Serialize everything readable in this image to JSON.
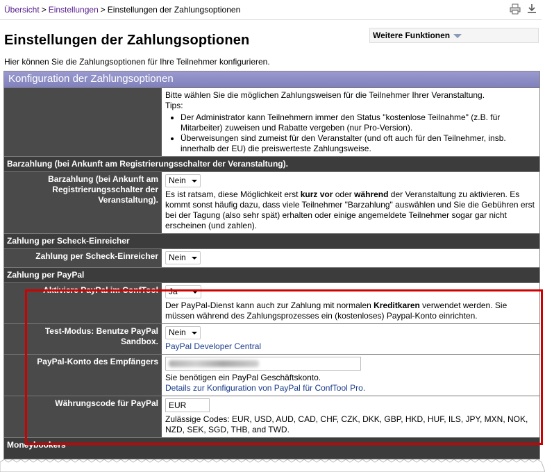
{
  "breadcrumb": {
    "home": "Übersicht",
    "settings": "Einstellungen",
    "current": "Einstellungen der Zahlungsoptionen",
    "sep": ">"
  },
  "header": {
    "title": "Einstellungen der Zahlungsoptionen",
    "more_functions": "Weitere Funktionen",
    "intro": "Hier können Sie die Zahlungsoptionen für Ihre Teilnehmer konfigurieren."
  },
  "config": {
    "heading": "Konfiguration der Zahlungsoptionen",
    "intro_text": "Bitte wählen Sie die möglichen Zahlungsweisen für die Teilnehmer Ihrer Veranstaltung.",
    "tips_label": "Tips:",
    "tips": [
      "Der Administrator kann Teilnehmern immer den Status \"kostenlose Teilnahme\" (z.B. für Mitarbeiter) zuweisen und Rabatte vergeben (nur Pro-Version).",
      "Überweisungen sind zumeist für den Veranstalter (und oft auch für den Teilnehmer, insb. innerhalb der EU) die preiswerteste Zahlungsweise."
    ]
  },
  "cash": {
    "section": "Barzahlung (bei Ankunft am Registrierungsschalter der Veranstaltung).",
    "label": "Barzahlung (bei Ankunft am Registrierungsschalter der Veranstaltung).",
    "value": "Nein",
    "note_1": "Es ist ratsam, diese Möglichkeit erst ",
    "note_bold_1": "kurz vor",
    "note_2": " oder ",
    "note_bold_2": "während",
    "note_3": " der Veranstaltung zu aktivieren. Es kommt sonst häufig dazu, dass viele Teilnehmer \"Barzahlung\" auswählen und Sie die Gebühren erst bei der Tagung (also sehr spät) erhalten oder einige angemeldete Teilnehmer sogar gar nicht erscheinen (und zahlen)."
  },
  "cheque": {
    "section": "Zahlung per Scheck-Einreicher",
    "label": "Zahlung per Scheck-Einreicher",
    "value": "Nein"
  },
  "paypal": {
    "section": "Zahlung per PayPal",
    "activate_label": "Aktiviere PayPal im ConfTool",
    "activate_value": "Ja",
    "activate_note_1": "Der PayPal-Dienst kann auch zur Zahlung mit normalen ",
    "activate_note_bold": "Kreditkaren",
    "activate_note_2": " verwendet werden. Sie müssen während des Zahlungsprozesses ein (kostenloses) Paypal-Konto einrichten.",
    "test_label": "Test-Modus: Benutze PayPal Sandbox.",
    "test_value": "Nein",
    "test_link": "PayPal Developer Central",
    "account_label": "PayPal-Konto des Empfängers",
    "account_note": "Sie benötigen ein PayPal Geschäftskonto.",
    "account_link": "Details zur Konfiguration von PayPal für ConfTool Pro.",
    "currency_label": "Währungscode für PayPal",
    "currency_value": "EUR",
    "currency_note": "Zulässige Codes: EUR, USD, AUD, CAD, CHF, CZK, DKK, GBP, HKD, HUF, ILS, JPY, MXN, NOK, NZD, SEK, SGD, THB, and TWD."
  },
  "moneybookers": {
    "section": "Moneybookers"
  },
  "colors": {
    "accent_header": "#8d8dc4",
    "highlight_box": "#d10000",
    "label_bg": "#4a4a4a"
  }
}
